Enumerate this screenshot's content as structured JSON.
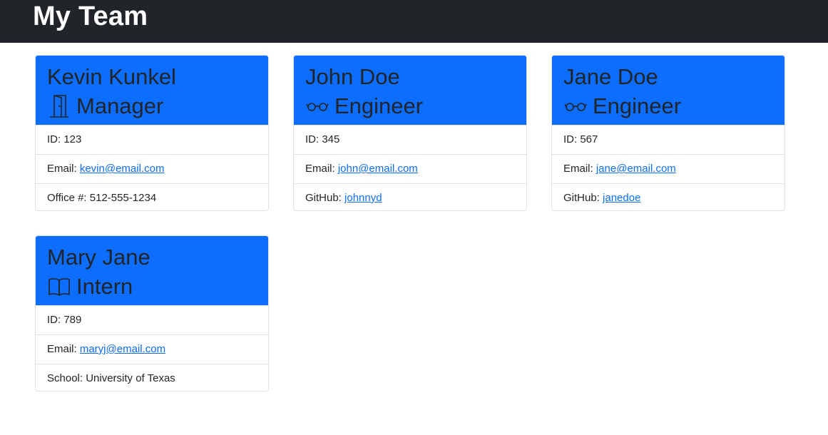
{
  "navbar": {
    "title": "My Team"
  },
  "cards": [
    {
      "name": "Kevin Kunkel",
      "role": "Manager",
      "icon": "door-icon",
      "id_label": "ID: ",
      "id_value": "123",
      "email_label": "Email: ",
      "email_value": "kevin@email.com",
      "extra_label": "Office #: ",
      "extra_value": "512-555-1234"
    },
    {
      "name": "John Doe",
      "role": "Engineer",
      "icon": "eyeglasses-icon",
      "id_label": "ID: ",
      "id_value": "345",
      "email_label": "Email: ",
      "email_value": "john@email.com",
      "extra_label": "GitHub: ",
      "extra_value": "johnnyd"
    },
    {
      "name": "Jane Doe",
      "role": "Engineer",
      "icon": "eyeglasses-icon",
      "id_label": "ID: ",
      "id_value": "567",
      "email_label": "Email: ",
      "email_value": "jane@email.com",
      "extra_label": "GitHub: ",
      "extra_value": "janedoe"
    },
    {
      "name": "Mary Jane",
      "role": "Intern",
      "icon": "book-icon",
      "id_label": "ID: ",
      "id_value": "789",
      "email_label": "Email: ",
      "email_value": "maryj@email.com",
      "extra_label": "School: ",
      "extra_value": "University of Texas"
    }
  ],
  "colors": {
    "navbar_bg": "#212529",
    "header_bg": "#0d6efd",
    "link": "#0d6efd",
    "border": "#dee2e6"
  }
}
